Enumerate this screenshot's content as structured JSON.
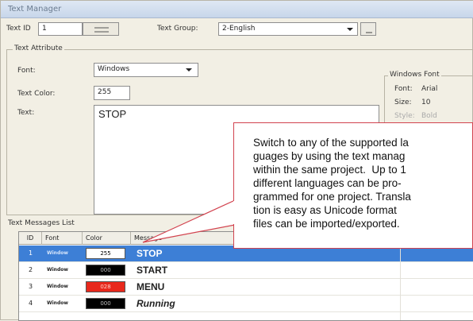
{
  "window": {
    "title": "Text Manager"
  },
  "top": {
    "text_id_label": "Text ID",
    "text_id_value": "1",
    "text_group_label": "Text Group:",
    "text_group_value": "2-English"
  },
  "attributes": {
    "group_title": "Text Attribute",
    "font_label": "Font:",
    "font_value": "Windows",
    "text_color_label": "Text Color:",
    "text_color_value": "255",
    "text_label": "Text:",
    "text_value": "STOP"
  },
  "windows_font": {
    "group_title": "Windows Font",
    "font_label": "Font:",
    "font_value": "Arial",
    "size_label": "Size:",
    "size_value": "10",
    "style_label": "Style:",
    "style_value": "Bold"
  },
  "messages": {
    "list_label": "Text Messages List",
    "columns": [
      "ID",
      "Font",
      "Color",
      "Message"
    ],
    "rows": [
      {
        "id": "1",
        "font": "Window",
        "color": "255",
        "message": "STOP",
        "color_bg": "#ffffff",
        "color_fg": "#000000",
        "selected": true
      },
      {
        "id": "2",
        "font": "Window",
        "color": "000",
        "message": "START",
        "color_bg": "#000000",
        "color_fg": "#bdbdbd",
        "selected": false
      },
      {
        "id": "3",
        "font": "Window",
        "color": "028",
        "message": "MENU",
        "color_bg": "#e8281c",
        "color_fg": "#ffd1c8",
        "selected": false
      },
      {
        "id": "4",
        "font": "Window",
        "color": "000",
        "message": "Running",
        "color_bg": "#000000",
        "color_fg": "#bdbdbd",
        "selected": false,
        "italic": true
      }
    ]
  },
  "callout": {
    "text": "Switch to any of the supported la\nguages by using the text manag\nwithin the same project.  Up to 1\ndifferent languages can be pro-\ngrammed for one project. Transla\ntion is easy as Unicode format\nfiles can be imported/exported."
  },
  "colors": {
    "selection": "#3d7fd6",
    "callout_border": "#d2434f"
  }
}
